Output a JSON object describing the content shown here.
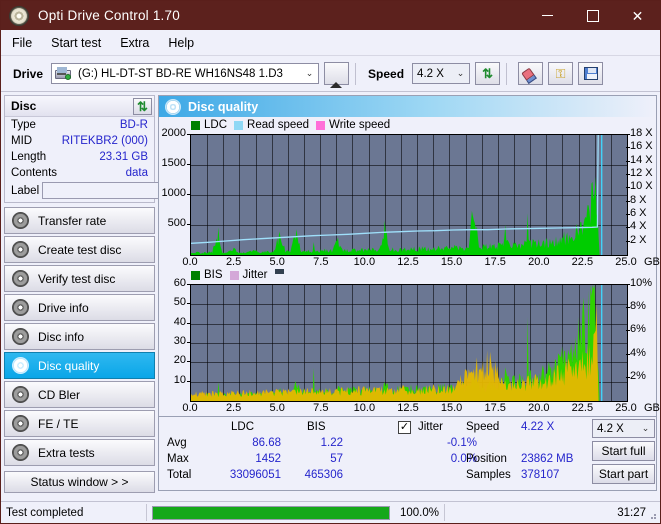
{
  "window": {
    "title": "Opti Drive Control 1.70",
    "icon": "disc-icon",
    "minimize": "—",
    "maximize": "□",
    "close": "✕",
    "titlebar_color": "#5c211d"
  },
  "menu": {
    "items": [
      "File",
      "Start test",
      "Extra",
      "Help"
    ]
  },
  "toolbar": {
    "drive_label": "Drive",
    "drive_value": "(G:)  HL-DT-ST BD-RE  WH16NS48 1.D3",
    "eject_icon": "eject-icon",
    "speed_label": "Speed",
    "speed_value": "4.2 X",
    "refresh_icon": "refresh-icon",
    "erase_icon": "eraser-icon",
    "keys_icon": "keys-icon",
    "save_icon": "save-icon",
    "arrow": "⌄"
  },
  "disc_panel": {
    "title": "Disc",
    "refresh_icon": "refresh-icon",
    "rows": [
      {
        "key": "Type",
        "value": "BD-R"
      },
      {
        "key": "MID",
        "value": "RITEKBR2 (000)"
      },
      {
        "key": "Length",
        "value": "23.31 GB"
      },
      {
        "key": "Contents",
        "value": "data"
      }
    ],
    "label_key": "Label",
    "label_value": "",
    "disc_icon": "disc-icon"
  },
  "nav": {
    "items": [
      {
        "label": "Transfer rate",
        "icon": "disc-icon",
        "active": false
      },
      {
        "label": "Create test disc",
        "icon": "disc-icon",
        "active": false
      },
      {
        "label": "Verify test disc",
        "icon": "disc-icon",
        "active": false
      },
      {
        "label": "Drive info",
        "icon": "disc-icon",
        "active": false
      },
      {
        "label": "Disc info",
        "icon": "disc-icon",
        "active": false
      },
      {
        "label": "Disc quality",
        "icon": "disc-icon",
        "active": true
      },
      {
        "label": "CD Bler",
        "icon": "disc-icon",
        "active": false
      },
      {
        "label": "FE / TE",
        "icon": "disc-icon",
        "active": false
      },
      {
        "label": "Extra tests",
        "icon": "disc-icon",
        "active": false
      }
    ],
    "status_window": "Status window > >"
  },
  "card": {
    "title": "Disc quality",
    "icon": "disc-icon"
  },
  "chart_data": [
    {
      "type": "area",
      "title": "LDC / Read speed",
      "xlabel": "GB",
      "ylabel": "",
      "xlim": [
        0,
        25
      ],
      "ylim": [
        0,
        2000
      ],
      "y2lim": [
        0,
        18
      ],
      "y2label": "X",
      "xticks": [
        "0.0",
        "2.5",
        "5.0",
        "7.5",
        "10.0",
        "12.5",
        "15.0",
        "17.5",
        "20.0",
        "22.5",
        "25.0"
      ],
      "yticks": [
        "500",
        "1000",
        "1500",
        "2000"
      ],
      "y2ticks": [
        "2 X",
        "4 X",
        "6 X",
        "8 X",
        "10 X",
        "12 X",
        "14 X",
        "16 X",
        "18 X"
      ],
      "grid": true,
      "legend_position": "top-left",
      "legend": [
        {
          "label": "LDC",
          "color": "#00b000"
        },
        {
          "label": "Read speed",
          "color": "#8fd8f5"
        },
        {
          "label": "Write speed",
          "color": "#ff6ed8"
        }
      ],
      "series": [
        {
          "name": "LDC",
          "color": "#00cc00",
          "x": [
            0.0,
            0.3,
            0.6,
            0.9,
            1.2,
            1.5,
            1.8,
            2.1,
            2.4,
            2.7,
            3.0,
            3.3,
            3.6,
            3.9,
            4.2,
            4.5,
            4.8,
            5.1,
            5.4,
            5.7,
            6.0,
            6.3,
            6.6,
            6.9,
            7.2,
            7.5,
            7.8,
            8.1,
            8.4,
            8.7,
            9.0,
            9.3,
            9.6,
            9.9,
            10.2,
            10.5,
            10.8,
            11.1,
            11.4,
            11.7,
            12.0,
            12.3,
            12.6,
            12.9,
            13.2,
            13.5,
            13.8,
            14.1,
            14.4,
            14.7,
            15.0,
            15.3,
            15.6,
            15.9,
            16.2,
            16.5,
            16.8,
            17.1,
            17.4,
            17.7,
            18.0,
            18.3,
            18.6,
            18.9,
            19.2,
            19.5,
            19.8,
            20.1,
            20.4,
            20.7,
            21.0,
            21.3,
            21.6,
            21.9,
            22.2,
            22.5,
            22.8,
            23.1,
            23.3,
            23.4
          ],
          "y": [
            30,
            45,
            40,
            55,
            48,
            330,
            60,
            52,
            140,
            58,
            62,
            55,
            70,
            58,
            66,
            62,
            75,
            500,
            80,
            70,
            545,
            90,
            78,
            85,
            80,
            95,
            88,
            92,
            300,
            96,
            90,
            100,
            95,
            110,
            100,
            105,
            98,
            515,
            108,
            112,
            110,
            115,
            120,
            118,
            125,
            122,
            130,
            128,
            135,
            132,
            140,
            145,
            142,
            150,
            880,
            160,
            155,
            165,
            170,
            180,
            250,
            190,
            200,
            210,
            220,
            215,
            230,
            240,
            250,
            270,
            290,
            320,
            360,
            420,
            500,
            620,
            900,
            1452,
            1200,
            0
          ]
        },
        {
          "name": "Read speed",
          "color": "#9fe0fb",
          "x": [
            0.0,
            1.0,
            2.0,
            3.0,
            4.0,
            5.0,
            6.0,
            7.0,
            8.0,
            9.0,
            10.0,
            11.0,
            12.0,
            13.0,
            14.0,
            15.0,
            16.0,
            17.0,
            18.0,
            19.0,
            20.0,
            21.0,
            22.0,
            23.0,
            23.3,
            23.35
          ],
          "y": [
            1.75,
            1.9,
            2.1,
            2.3,
            2.45,
            2.6,
            2.75,
            2.9,
            3.0,
            3.1,
            3.25,
            3.4,
            3.5,
            3.6,
            3.65,
            3.75,
            3.8,
            3.8,
            3.9,
            3.95,
            4.0,
            4.05,
            4.1,
            4.15,
            4.2,
            18.0
          ]
        }
      ]
    },
    {
      "type": "area",
      "title": "BIS / Jitter",
      "xlabel": "GB",
      "ylabel": "",
      "xlim": [
        0,
        25
      ],
      "ylim": [
        0,
        60
      ],
      "y2lim": [
        0,
        10
      ],
      "y2label": "%",
      "xticks": [
        "0.0",
        "2.5",
        "5.0",
        "7.5",
        "10.0",
        "12.5",
        "15.0",
        "17.5",
        "20.0",
        "22.5",
        "25.0"
      ],
      "yticks": [
        "10",
        "20",
        "30",
        "40",
        "50",
        "60"
      ],
      "y2ticks": [
        "2%",
        "4%",
        "6%",
        "8%",
        "10%"
      ],
      "grid": true,
      "legend_position": "top-left",
      "legend": [
        {
          "label": "BIS",
          "color": "#00b000"
        },
        {
          "label": "Jitter",
          "color": "#d4a8d8"
        }
      ],
      "series": [
        {
          "name": "BIS",
          "color": "#2fd200",
          "x": [
            0.0,
            0.3,
            0.6,
            0.9,
            1.2,
            1.5,
            1.8,
            2.1,
            2.4,
            2.7,
            3.0,
            3.3,
            3.6,
            3.9,
            4.2,
            4.5,
            4.8,
            5.1,
            5.4,
            5.7,
            6.0,
            6.3,
            6.6,
            6.9,
            7.2,
            7.5,
            7.8,
            8.1,
            8.4,
            8.7,
            9.0,
            9.3,
            9.6,
            9.9,
            10.2,
            10.5,
            10.8,
            11.1,
            11.4,
            11.7,
            12.0,
            12.3,
            12.6,
            12.9,
            13.2,
            13.5,
            13.8,
            14.1,
            14.4,
            14.7,
            15.0,
            15.3,
            15.6,
            15.9,
            16.2,
            16.5,
            16.8,
            17.1,
            17.4,
            17.7,
            18.0,
            18.3,
            18.6,
            18.9,
            19.2,
            19.5,
            19.8,
            20.1,
            20.4,
            20.7,
            21.0,
            21.3,
            21.6,
            21.9,
            22.2,
            22.5,
            22.8,
            23.1,
            23.3,
            23.4
          ],
          "y": [
            2,
            3,
            2.5,
            3.5,
            3,
            4,
            3.2,
            3.8,
            4,
            3.5,
            4.2,
            3.6,
            4.5,
            4,
            4.8,
            4.2,
            5,
            6,
            5.2,
            4.6,
            9,
            6,
            5,
            5.5,
            5,
            6,
            5.5,
            6,
            7,
            6.2,
            6,
            6.5,
            6,
            7,
            6.5,
            6.8,
            6.2,
            9,
            7,
            7.5,
            7,
            7.2,
            7.5,
            7,
            7.8,
            7.2,
            8,
            7.5,
            8.2,
            7.8,
            8,
            8.5,
            8.2,
            8.6,
            18,
            9,
            8.5,
            9,
            9.5,
            10,
            14,
            11,
            12,
            13,
            14,
            13.5,
            15,
            16,
            17,
            19,
            21,
            24,
            27,
            32,
            38,
            45,
            50,
            57,
            48,
            0
          ]
        },
        {
          "name": "Jitter",
          "color": "#e6b800",
          "x": [
            0.0,
            3.0,
            6.0,
            9.0,
            12.0,
            15.0,
            17.0,
            18.0,
            19.0,
            20.0,
            21.0,
            21.5,
            22.0,
            22.3,
            22.6,
            22.9,
            23.1,
            23.25,
            23.3,
            23.35
          ],
          "y": [
            0.6,
            0.7,
            0.8,
            0.9,
            1.0,
            1.1,
            3.5,
            1.3,
            1.5,
            1.8,
            2.2,
            2.6,
            2.8,
            3.2,
            3.4,
            3.8,
            4.2,
            6.0,
            8.0,
            0
          ]
        }
      ]
    }
  ],
  "stats": {
    "col_headers": [
      "LDC",
      "BIS"
    ],
    "rows": [
      {
        "label": "Avg",
        "ldc": "86.68",
        "bis": "1.22"
      },
      {
        "label": "Max",
        "ldc": "1452",
        "bis": "57"
      },
      {
        "label": "Total",
        "ldc": "33096051",
        "bis": "465306"
      }
    ],
    "jitter_checkbox_label": "Jitter",
    "jitter_checked": "✓",
    "jitter_values": [
      "-0.1%",
      "0.0%"
    ],
    "speed_label": "Speed",
    "speed_value": "4.22 X",
    "position_label": "Position",
    "position_value": "23862 MB",
    "samples_label": "Samples",
    "samples_value": "378107",
    "speed_select": "4.2 X",
    "speed_select_arrow": "⌄",
    "start_full": "Start full",
    "start_part": "Start part"
  },
  "statusbar": {
    "message": "Test completed",
    "progress_percent": "100.0%",
    "progress_value": 100,
    "elapsed": "31:27"
  }
}
